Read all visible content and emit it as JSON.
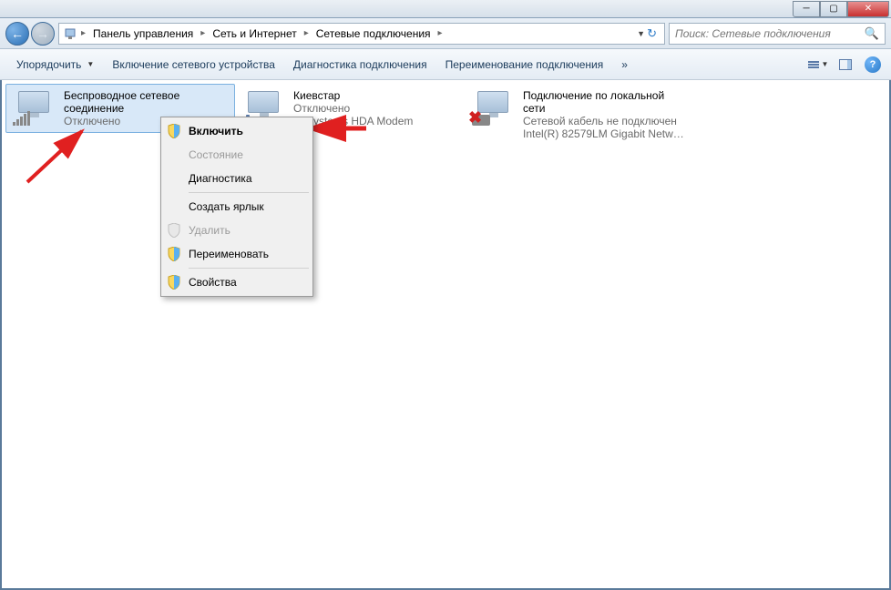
{
  "breadcrumb": {
    "items": [
      "Панель управления",
      "Сеть и Интернет",
      "Сетевые подключения"
    ]
  },
  "search": {
    "placeholder": "Поиск: Сетевые подключения"
  },
  "toolbar": {
    "organize": "Упорядочить",
    "enable_device": "Включение сетевого устройства",
    "diagnose": "Диагностика подключения",
    "rename": "Переименование подключения",
    "overflow": "»"
  },
  "connections": [
    {
      "name": "Беспроводное сетевое соединение",
      "status": "Отключено",
      "detail": "",
      "type": "wifi",
      "selected": true
    },
    {
      "name": "Киевстар",
      "status": "Отключено",
      "detail": "re Systems HDA Modem",
      "type": "modem",
      "selected": false
    },
    {
      "name": "Подключение по локальной сети",
      "status": "Сетевой кабель не подключен",
      "detail": "Intel(R) 82579LM Gigabit Network...",
      "type": "ethernet",
      "selected": false,
      "error": true
    }
  ],
  "context_menu": {
    "enable": "Включить",
    "status": "Состояние",
    "diagnose": "Диагностика",
    "create_shortcut": "Создать ярлык",
    "delete": "Удалить",
    "rename": "Переименовать",
    "properties": "Свойства"
  }
}
